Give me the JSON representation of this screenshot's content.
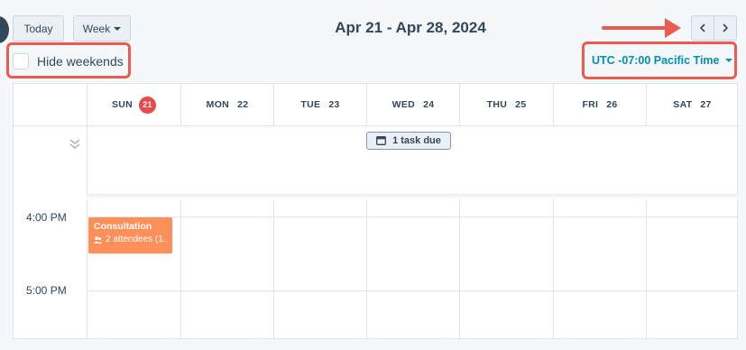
{
  "toolbar": {
    "today_label": "Today",
    "view_label": "Week",
    "date_range": "Apr 21 - Apr 28, 2024",
    "prev_icon": "chevron-left-icon",
    "next_icon": "chevron-right-icon"
  },
  "options": {
    "hide_weekends_label": "Hide weekends",
    "hide_weekends_checked": false,
    "timezone_label": "UTC -07:00 Pacific Time"
  },
  "days": [
    {
      "name": "SUN",
      "num": "21",
      "is_today": true
    },
    {
      "name": "MON",
      "num": "22"
    },
    {
      "name": "TUE",
      "num": "23"
    },
    {
      "name": "WED",
      "num": "24"
    },
    {
      "name": "THU",
      "num": "25"
    },
    {
      "name": "FRI",
      "num": "26"
    },
    {
      "name": "SAT",
      "num": "27"
    }
  ],
  "all_day": {
    "task_chip": "1 task due"
  },
  "times": [
    "4:00 PM",
    "5:00 PM"
  ],
  "event": {
    "title": "Consultation",
    "subtitle": "2 attendees (1..."
  },
  "colors": {
    "highlight": "#ed5a4f",
    "today_badge": "#e64a4a",
    "event": "#ff8f59",
    "timezone": "#0091ae"
  }
}
